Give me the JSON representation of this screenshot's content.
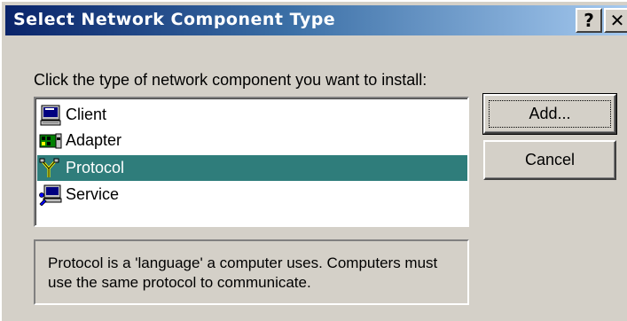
{
  "window": {
    "title": "Select Network Component Type",
    "help_glyph": "?",
    "close_glyph": "✕"
  },
  "instruction": "Click the type of network component you want to install:",
  "list": {
    "items": [
      {
        "label": "Client",
        "icon": "client-computer-icon",
        "selected": false
      },
      {
        "label": "Adapter",
        "icon": "network-adapter-icon",
        "selected": false
      },
      {
        "label": "Protocol",
        "icon": "protocol-icon",
        "selected": true
      },
      {
        "label": "Service",
        "icon": "service-icon",
        "selected": false
      }
    ],
    "selection_color": "#2f7d7b"
  },
  "buttons": {
    "add_label": "Add...",
    "cancel_label": "Cancel"
  },
  "description": "Protocol is a 'language' a computer uses. Computers must use the same protocol to communicate."
}
